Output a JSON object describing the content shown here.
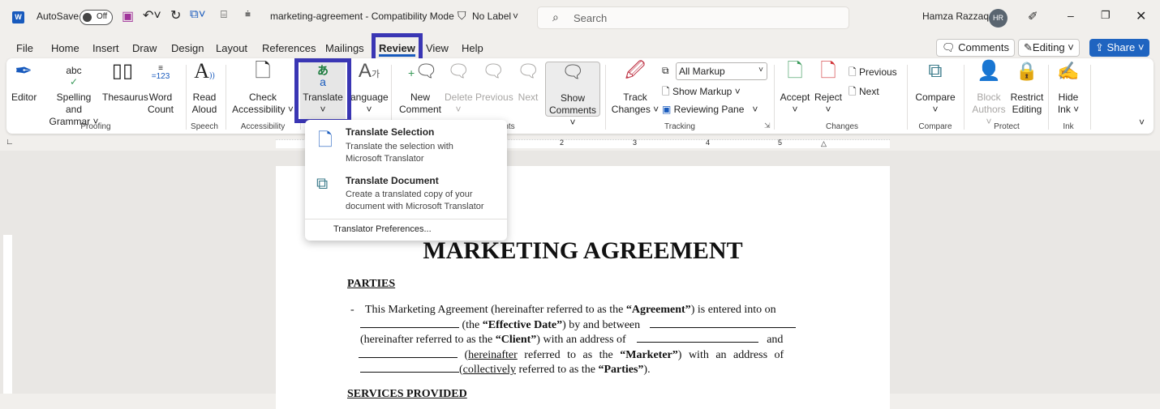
{
  "titlebar": {
    "autosave_label": "AutoSave",
    "autosave_state": "Off",
    "doc_title": "marketing-agreement - Compatibility Mode",
    "label": "No Label",
    "search_placeholder": "Search",
    "user_name": "Hamza Razzaq",
    "user_initials": "HR"
  },
  "menu": {
    "tabs": [
      "File",
      "Home",
      "Insert",
      "Draw",
      "Design",
      "Layout",
      "References",
      "Mailings",
      "Review",
      "View",
      "Help"
    ],
    "active": "Review",
    "comments": "Comments",
    "editing": "Editing",
    "share": "Share"
  },
  "ribbon": {
    "proofing": {
      "label": "Proofing",
      "editor": "Editor",
      "spelling": "Spelling and",
      "spelling2": "Grammar",
      "thesaurus": "Thesaurus",
      "word_count": "Word",
      "word_count2": "Count"
    },
    "speech": {
      "label": "Speech",
      "read": "Read",
      "read2": "Aloud"
    },
    "accessibility": {
      "label": "Accessibility",
      "check": "Check",
      "check2": "Accessibility"
    },
    "language": {
      "translate": "Translate",
      "language": "anguage"
    },
    "comments": {
      "label": "nts",
      "new": "New",
      "new2": "Comment",
      "delete": "Delete",
      "previous": "Previous",
      "next": "Next",
      "show": "Show",
      "show2": "Comments"
    },
    "tracking": {
      "label": "Tracking",
      "track": "Track",
      "track2": "Changes",
      "markup_select": "All Markup",
      "show_markup": "Show Markup",
      "reviewing_pane": "Reviewing Pane"
    },
    "changes": {
      "label": "Changes",
      "accept": "Accept",
      "reject": "Reject",
      "previous": "Previous",
      "next": "Next"
    },
    "compare": {
      "label": "Compare",
      "compare": "Compare"
    },
    "protect": {
      "label": "Protect",
      "block": "Block",
      "block2": "Authors",
      "restrict": "Restrict",
      "restrict2": "Editing"
    },
    "ink": {
      "label": "Ink",
      "hide": "Hide",
      "hide2": "Ink"
    }
  },
  "dropdown": {
    "items": [
      {
        "title": "Translate Selection",
        "desc1": "Translate the selection with",
        "desc2": "Microsoft Translator"
      },
      {
        "title": "Translate Document",
        "desc1": "Create a translated copy of your",
        "desc2": "document with Microsoft Translator"
      }
    ],
    "preferences": "Translator Preferences..."
  },
  "ruler": {
    "marks": [
      "2",
      "3",
      "4",
      "5"
    ]
  },
  "document": {
    "title": "MARKETING AGREEMENT",
    "section1": "PARTIES",
    "bullet": "-",
    "p1a": "This Marketing Agreement (hereinafter referred to as the ",
    "p1b": "“Agreement”",
    "p1c": ") is entered into on",
    "p2a": " (the ",
    "p2b": "“Effective Date”",
    "p2c": ") by and between",
    "p3a": "(hereinafter referred to as the ",
    "p3b": "“Client”",
    "p3c": ") with an address of",
    "p3d": "and",
    "p4a": "hereinafter",
    "p4b": " referred to as the ",
    "p4c": "“Marketer”",
    "p4d": ") with an address of",
    "p5a": "collectively",
    "p5b": " referred to as the ",
    "p5c": "“Parties”",
    "p5d": ").",
    "section2": "SERVICES PROVIDED"
  },
  "colors": {
    "highlight": "#3a36b4",
    "share": "#1f64c0",
    "word_blue": "#185abd"
  }
}
